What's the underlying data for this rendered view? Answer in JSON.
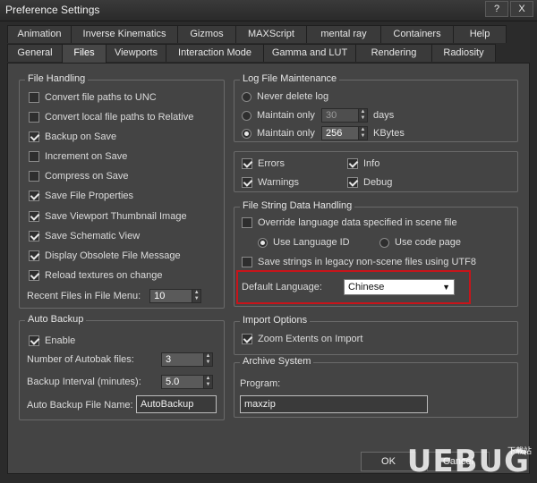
{
  "window": {
    "title": "Preference Settings",
    "help_btn": "?",
    "close_btn": "X"
  },
  "tabs_row1": [
    "Animation",
    "Inverse Kinematics",
    "Gizmos",
    "MAXScript",
    "mental ray",
    "Containers",
    "Help"
  ],
  "tabs_row2": [
    "General",
    "Files",
    "Viewports",
    "Interaction Mode",
    "Gamma and LUT",
    "Rendering",
    "Radiosity"
  ],
  "file_handling": {
    "legend": "File Handling",
    "options": [
      {
        "label": "Convert file paths to UNC",
        "checked": false
      },
      {
        "label": "Convert local file paths to Relative",
        "checked": false
      },
      {
        "label": "Backup on Save",
        "checked": true
      },
      {
        "label": "Increment on Save",
        "checked": false
      },
      {
        "label": "Compress on Save",
        "checked": false
      },
      {
        "label": "Save File Properties",
        "checked": true
      },
      {
        "label": "Save Viewport Thumbnail Image",
        "checked": true
      },
      {
        "label": "Save Schematic View",
        "checked": true
      },
      {
        "label": "Display Obsolete File Message",
        "checked": true
      },
      {
        "label": "Reload textures on change",
        "checked": true
      }
    ],
    "recent_label": "Recent Files in File Menu:",
    "recent_value": "10"
  },
  "auto_backup": {
    "legend": "Auto Backup",
    "enable_label": "Enable",
    "enable_checked": true,
    "num_label": "Number of Autobak files:",
    "num_value": "3",
    "interval_label": "Backup Interval (minutes):",
    "interval_value": "5.0",
    "filename_label": "Auto Backup File Name:",
    "filename_value": "AutoBackup"
  },
  "log_maintenance": {
    "legend": "Log File Maintenance",
    "never_label": "Never delete log",
    "maintain_days_label": "Maintain only",
    "days_value": "30",
    "days_unit": "days",
    "maintain_kb_label": "Maintain only",
    "kb_value": "256",
    "kb_unit": "KBytes",
    "selected": "kbytes",
    "errors_label": "Errors",
    "info_label": "Info",
    "warnings_label": "Warnings",
    "debug_label": "Debug"
  },
  "file_string": {
    "legend": "File String Data Handling",
    "override_label": "Override language data specified in scene file",
    "use_language_id_label": "Use Language ID",
    "use_code_page_label": "Use code page",
    "utf8_label": "Save strings in legacy non-scene files using UTF8",
    "default_language_label": "Default Language:",
    "default_language_value": "Chinese"
  },
  "import_options": {
    "legend": "Import Options",
    "zoom_label": "Zoom Extents on Import"
  },
  "archive": {
    "legend": "Archive System",
    "program_label": "Program:",
    "program_value": "maxzip"
  },
  "footer": {
    "ok_label": "OK",
    "cancel_label": "Cancel"
  },
  "watermark": {
    "text": "UEBUG",
    "small": "下载站"
  },
  "colors": {
    "highlight": "#c8141a",
    "panel": "#444444",
    "background": "#2b2b2b"
  }
}
